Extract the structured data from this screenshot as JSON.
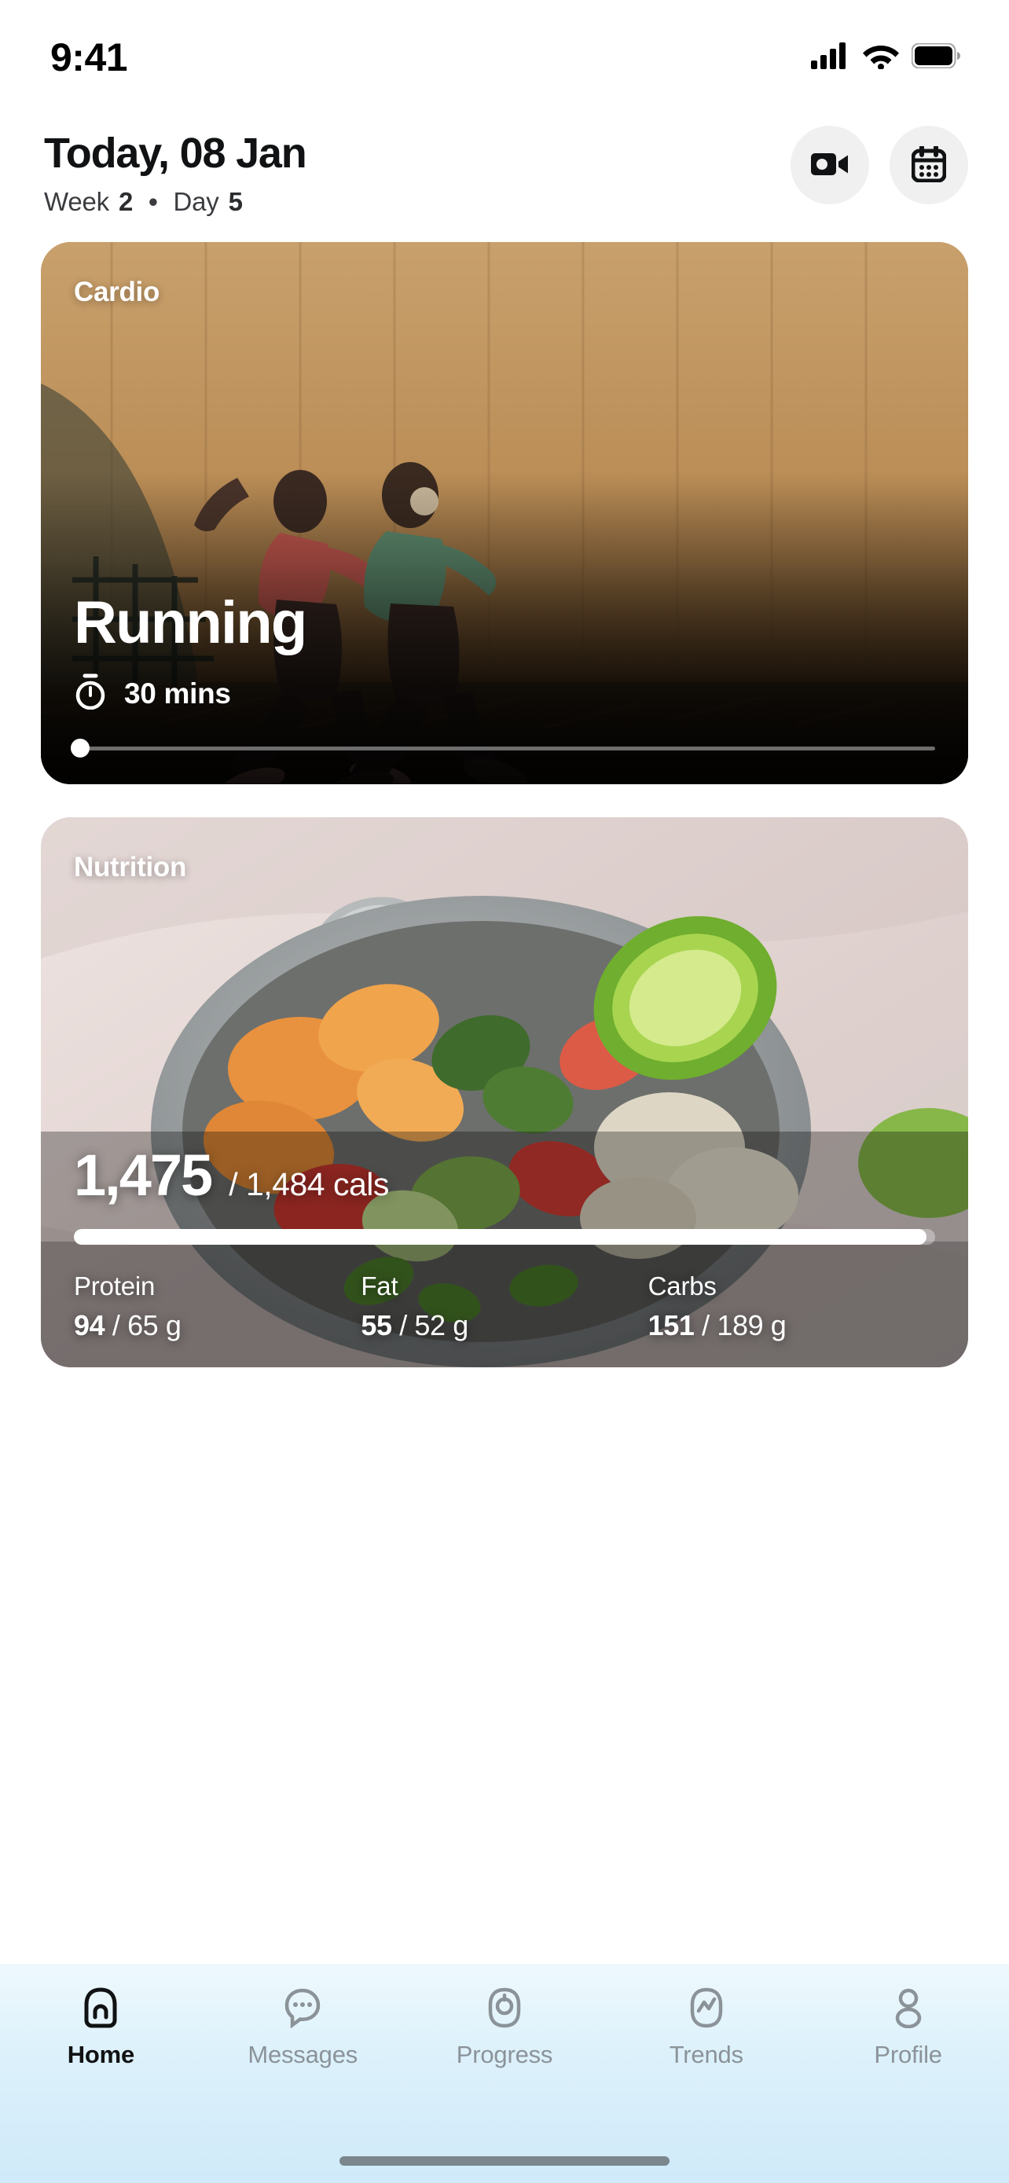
{
  "status_bar": {
    "time": "9:41",
    "icons": [
      "cellular-signal-icon",
      "wifi-icon",
      "battery-icon"
    ]
  },
  "header": {
    "title": "Today, 08 Jan",
    "subtitle": {
      "week_label": "Week",
      "week_value": "2",
      "separator": "•",
      "day_label": "Day",
      "day_value": "5"
    },
    "actions": [
      {
        "name": "video-camera-button",
        "icon": "video-camera-icon"
      },
      {
        "name": "calendar-button",
        "icon": "calendar-icon"
      }
    ]
  },
  "cards": {
    "cardio": {
      "tag": "Cardio",
      "title": "Running",
      "duration": "30 mins",
      "duration_icon": "stopwatch-icon",
      "progress_percent": 0
    },
    "nutrition": {
      "tag": "Nutrition",
      "calories_current": "1,475",
      "calories_total": "/ 1,484 cals",
      "progress_percent": 99,
      "macros": [
        {
          "label": "Protein",
          "current": "94",
          "target": "/ 65 g"
        },
        {
          "label": "Fat",
          "current": "55",
          "target": "/ 52 g"
        },
        {
          "label": "Carbs",
          "current": "151",
          "target": "/ 189 g"
        }
      ]
    }
  },
  "bottom_nav": {
    "items": [
      {
        "label": "Home",
        "icon": "home-icon",
        "active": true
      },
      {
        "label": "Messages",
        "icon": "chat-bubble-icon",
        "active": false
      },
      {
        "label": "Progress",
        "icon": "target-ring-icon",
        "active": false
      },
      {
        "label": "Trends",
        "icon": "trend-chart-icon",
        "active": false
      },
      {
        "label": "Profile",
        "icon": "person-icon",
        "active": false
      }
    ]
  },
  "colors": {
    "accent_white": "#ffffff",
    "text_primary": "#111213",
    "text_muted": "#8b9399",
    "nav_background": "#ddf1fb",
    "button_background": "#f0f0f0"
  }
}
